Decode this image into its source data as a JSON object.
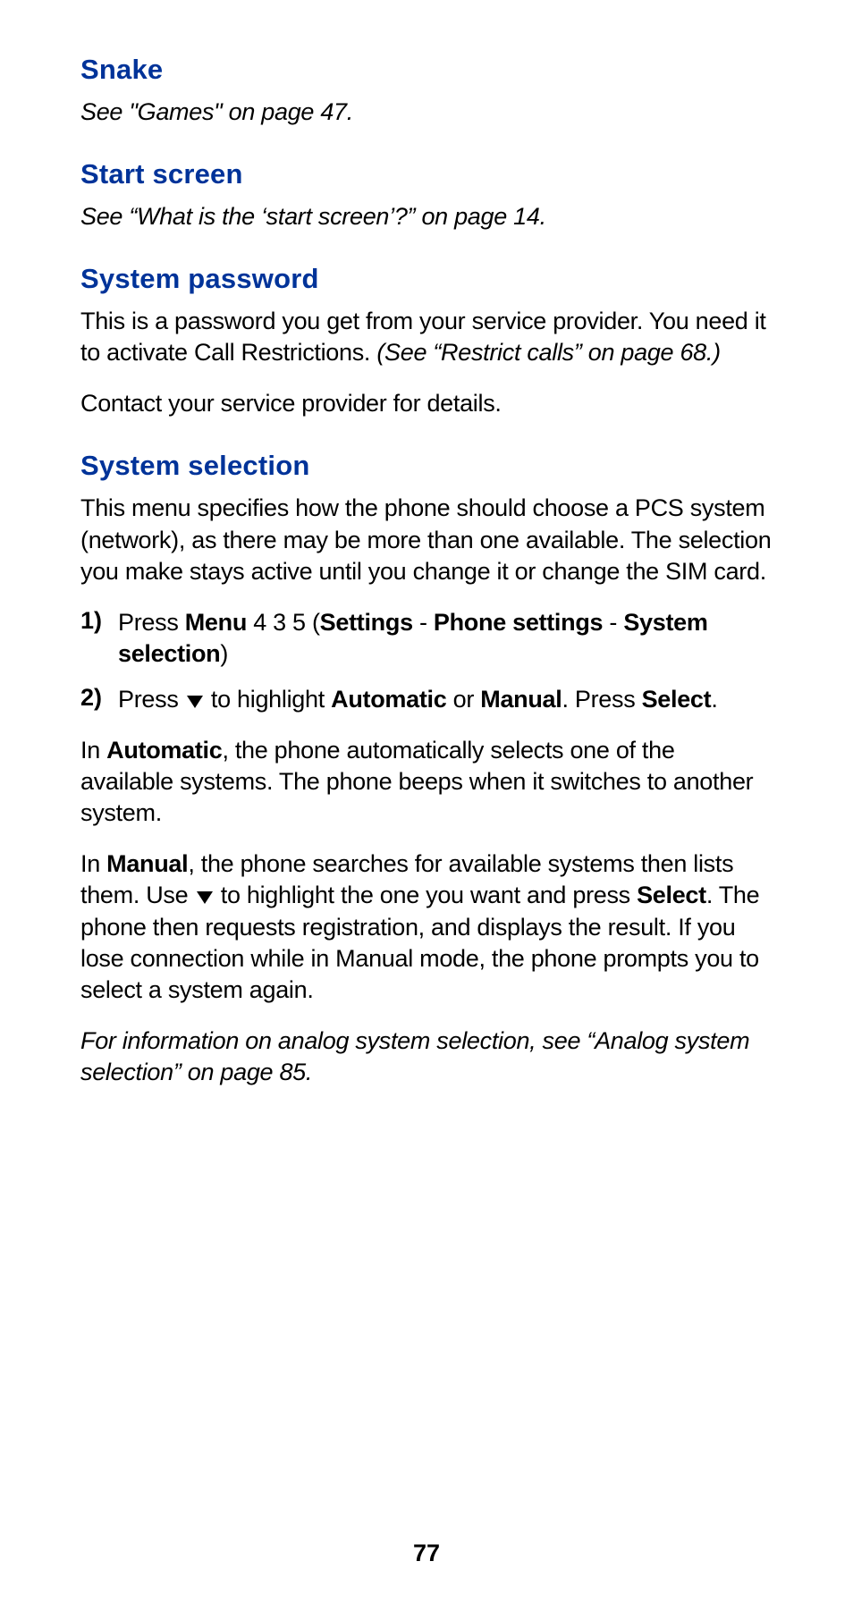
{
  "sections": {
    "snake": {
      "title": "Snake",
      "body": "See \"Games\" on page 47."
    },
    "start_screen": {
      "title": "Start screen",
      "body": "See “What is the ‘start screen’?” on page 14."
    },
    "system_password": {
      "title": "System password",
      "p1_lead": "This is a password you get from your service provider. You need it to activate Call Restrictions. ",
      "p1_italic": "(See “Restrict calls” on page 68.)",
      "p2": "Contact your service provider for details."
    },
    "system_selection": {
      "title": "System selection",
      "intro": "This menu specifies how the phone should choose a PCS system (network), as there may be more than one available. The selection you make stays active until you change it or change the SIM card.",
      "step1": {
        "marker": "1)",
        "t1": "Press ",
        "b1": "Menu",
        "t2": " 4 3 5 (",
        "b2": "Settings",
        "t3": " - ",
        "b3": "Phone settings",
        "t4": " - ",
        "b4": "System selection",
        "t5": ")"
      },
      "step2": {
        "marker": "2)",
        "t1": "Press ",
        "t2": " to highlight ",
        "b1": "Automatic",
        "t3": " or ",
        "b2": "Manual",
        "t4": ". Press ",
        "b3": "Select",
        "t5": "."
      },
      "auto_para": {
        "t1": "In ",
        "b1": "Automatic",
        "t2": ", the phone automatically selects one of the available systems. The phone beeps when it switches to another system."
      },
      "manual_para": {
        "t1": "In ",
        "b1": "Manual",
        "t2": ", the phone searches for available systems then lists them. Use ",
        "t3": " to highlight the one you want and press ",
        "b2": "Select",
        "t4": ". The phone then requests registration, and displays the result. If you lose connection while in Manual mode, the phone prompts you to select a system again."
      },
      "footnote": "For information on analog system selection, see “Analog system selection” on page 85."
    }
  },
  "page_number": "77"
}
